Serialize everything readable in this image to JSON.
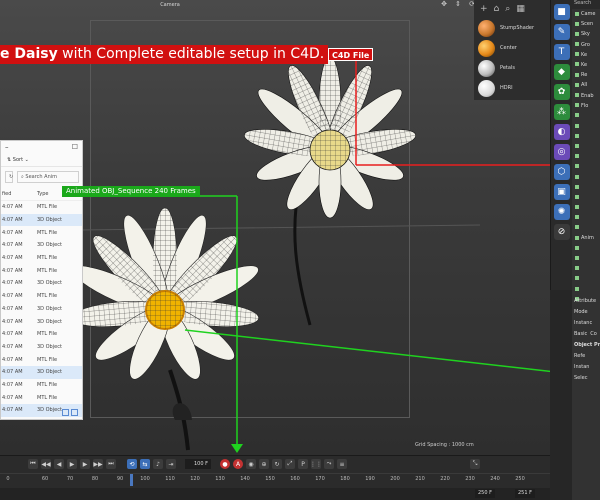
{
  "viewport": {
    "camera_label": "Camera",
    "grid_spacing": "Grid Spacing : 1000 cm"
  },
  "overlays": {
    "title_bold": "e Daisy",
    "title_rest": " with Complete editable setup in C4D.",
    "c4d_tag": "C4D File",
    "obj_tag": "Animated OBJ_Sequence 240 Frames"
  },
  "materials": [
    {
      "name": "StumpShader",
      "color": "#c9782d"
    },
    {
      "name": "Center",
      "color": "#e68a1a"
    },
    {
      "name": "Petals",
      "color": "#c8c8c8"
    },
    {
      "name": "HDRI",
      "color": "#e0e0e0"
    }
  ],
  "explorer": {
    "sort_label": "Sort",
    "search_placeholder": "Search Anim",
    "col_modified": "fied",
    "col_type": "Type",
    "rows": [
      {
        "time": "4:07 AM",
        "type": "MTL File"
      },
      {
        "time": "4:07 AM",
        "type": "3D Object"
      },
      {
        "time": "4:07 AM",
        "type": "MTL File"
      },
      {
        "time": "4:07 AM",
        "type": "3D Object"
      },
      {
        "time": "4:07 AM",
        "type": "MTL File"
      },
      {
        "time": "4:07 AM",
        "type": "MTL File"
      },
      {
        "time": "4:07 AM",
        "type": "3D Object"
      },
      {
        "time": "4:07 AM",
        "type": "MTL File"
      },
      {
        "time": "4:07 AM",
        "type": "3D Object"
      },
      {
        "time": "4:07 AM",
        "type": "3D Object"
      },
      {
        "time": "4:07 AM",
        "type": "MTL File"
      },
      {
        "time": "4:07 AM",
        "type": "3D Object"
      },
      {
        "time": "4:07 AM",
        "type": "MTL File"
      },
      {
        "time": "4:07 AM",
        "type": "3D Object"
      },
      {
        "time": "4:07 AM",
        "type": "MTL File"
      },
      {
        "time": "4:07 AM",
        "type": "MTL File"
      },
      {
        "time": "4:07 AM",
        "type": "3D Object"
      }
    ]
  },
  "object_manager": {
    "search": "Search",
    "items": [
      "Came",
      "Scen",
      "Sky",
      "Gro",
      "Ke",
      "Ke",
      "Re",
      "All",
      "Enab",
      "Flo",
      "",
      "",
      "",
      "",
      "",
      "",
      "",
      "",
      "",
      "",
      "",
      "",
      "Anim",
      "",
      "",
      "",
      "",
      "",
      ""
    ]
  },
  "attributes": {
    "title": "Attribute",
    "mode": "Mode",
    "instance": "Instanc",
    "tab_basic": "Basic",
    "tab_co": "Co",
    "section": "Object Pro",
    "ref": "Refe",
    "inst": "Instan",
    "sel": "Selec"
  },
  "timeline": {
    "frame_field": "100 F",
    "start_frame": "0",
    "end_field": "250 F",
    "end_field2": "251 F",
    "ticks": [
      "60",
      "70",
      "80",
      "90",
      "100",
      "110",
      "120",
      "130",
      "140",
      "150",
      "160",
      "170",
      "180",
      "190",
      "200",
      "210",
      "220",
      "230",
      "240",
      "250"
    ]
  },
  "colors": {
    "red_accent": "#d11010",
    "green_accent": "#1aa81a",
    "selection_blue": "#3c6fb8"
  }
}
